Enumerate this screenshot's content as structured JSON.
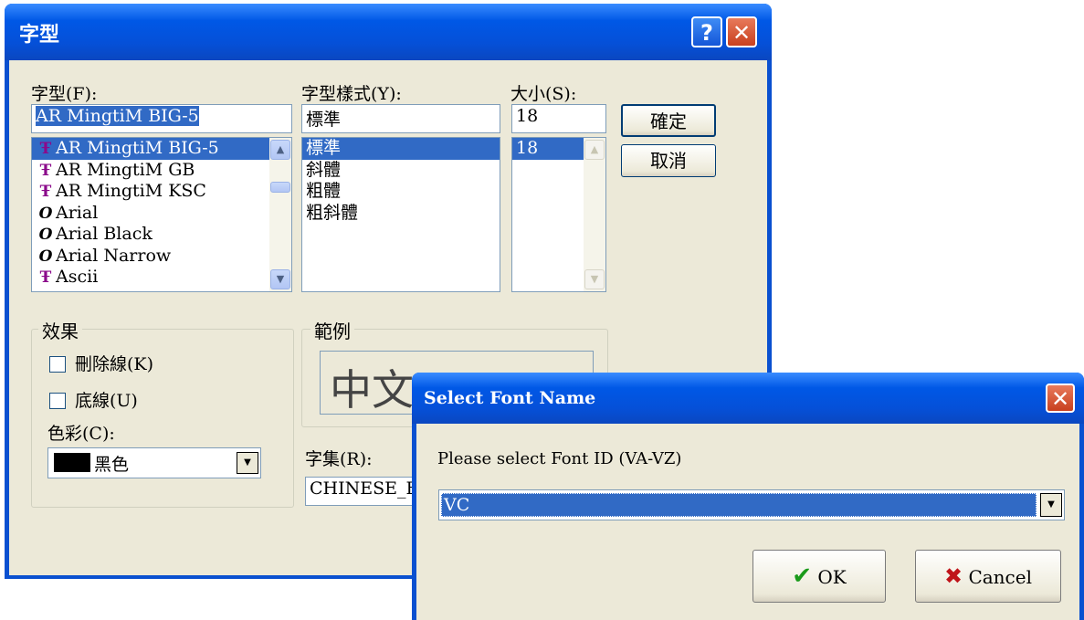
{
  "font_dialog": {
    "title": "字型",
    "help_label": "?",
    "close_label": "✕",
    "font_label": "字型(F):",
    "font_value": "AR MingtiM BIG-5",
    "style_label": "字型樣式(Y):",
    "style_value": "標準",
    "size_label": "大小(S):",
    "size_value": "18",
    "fonts": [
      {
        "icon": "truetype-icon",
        "glyph": "Ŧ",
        "name": "AR MingtiM BIG-5",
        "selected": true
      },
      {
        "icon": "truetype-icon",
        "glyph": "Ŧ",
        "name": "AR MingtiM GB",
        "selected": false
      },
      {
        "icon": "truetype-icon",
        "glyph": "Ŧ",
        "name": "AR MingtiM KSC",
        "selected": false
      },
      {
        "icon": "opentype-icon",
        "glyph": "O",
        "name": "Arial",
        "selected": false
      },
      {
        "icon": "opentype-icon",
        "glyph": "O",
        "name": "Arial Black",
        "selected": false
      },
      {
        "icon": "opentype-icon",
        "glyph": "O",
        "name": "Arial Narrow",
        "selected": false
      },
      {
        "icon": "truetype-icon",
        "glyph": "Ŧ",
        "name": "Ascii",
        "selected": false
      }
    ],
    "styles": [
      {
        "name": "標準",
        "selected": true
      },
      {
        "name": "斜體",
        "selected": false
      },
      {
        "name": "粗體",
        "selected": false
      },
      {
        "name": "粗斜體",
        "selected": false
      }
    ],
    "sizes": [
      {
        "name": "18",
        "selected": true
      }
    ],
    "ok_label": "確定",
    "cancel_label": "取消",
    "effects_label": "效果",
    "strikeout_label": "刪除線(K)",
    "underline_label": "底線(U)",
    "color_label": "色彩(C):",
    "color_value": "黑色",
    "color_swatch": "#000000",
    "sample_label": "範例",
    "sample_text": "中文",
    "charset_label": "字集(R):",
    "charset_value": "CHINESE_B"
  },
  "select_dialog": {
    "title": "Select Font Name",
    "close_label": "✕",
    "prompt": "Please select Font ID (VA-VZ)",
    "selected_id": "VC",
    "ok_label": "OK",
    "cancel_label": "Cancel"
  },
  "colors": {
    "titlebar": "#0058e6",
    "selection": "#316ac5",
    "dialog_face": "#ece9d8"
  }
}
